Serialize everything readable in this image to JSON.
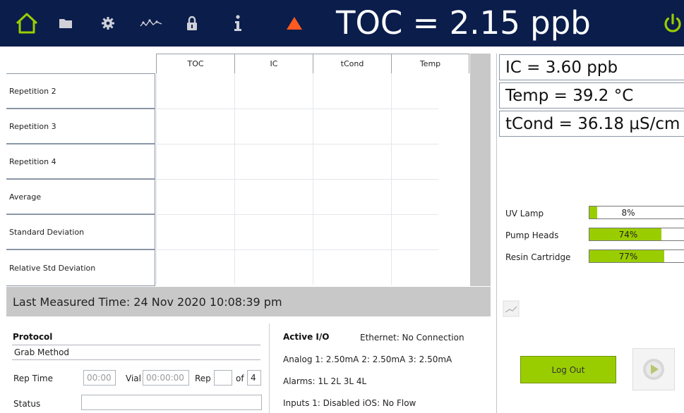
{
  "header": {
    "title": "TOC = 2.15 ppb",
    "icons": [
      "home-icon",
      "folder-icon",
      "gear-icon",
      "trend-icon",
      "lock-icon",
      "info-icon",
      "warning-triangle-icon",
      "power-icon"
    ],
    "colors": {
      "bar": "#0a1d4b",
      "home": "#9acd00",
      "warning": "#ff5a1f",
      "power": "#9acd00"
    }
  },
  "results_table": {
    "columns": [
      "TOC",
      "IC",
      "tCond",
      "Temp"
    ],
    "rows": [
      "Repetition 2",
      "Repetition 3",
      "Repetition 4",
      "Average",
      "Standard Deviation",
      "Relative Std Deviation"
    ],
    "last_measured": "Last Measured Time:  24 Nov 2020  10:08:39 pm"
  },
  "readouts": {
    "ic": "IC = 3.60 ppb",
    "temp": "Temp = 39.2 °C",
    "tcond": "tCond = 36.18 μS/cm"
  },
  "consumables": [
    {
      "label": "UV Lamp",
      "percent": 8,
      "text": "8%"
    },
    {
      "label": "Pump Heads",
      "percent": 74,
      "text": "74%"
    },
    {
      "label": "Resin Cartridge",
      "percent": 77,
      "text": "77%"
    }
  ],
  "protocol": {
    "title": "Protocol",
    "method": "Grab Method",
    "rep_time_label": "Rep Time",
    "rep_time_value": "00:00",
    "vial_label": "Vial",
    "vial_value": "00:00:00",
    "rep_label": "Rep",
    "of_label": "of",
    "rep_total": "4",
    "status_label": "Status",
    "status_value": ""
  },
  "active_io": {
    "title": "Active I/O",
    "ethernet": "Ethernet: No Connection",
    "analog": "Analog 1: 2.50mA  2: 2.50mA  3: 2.50mA",
    "alarms": "Alarms: 1L 2L 3L 4L",
    "inputs": "Inputs 1: Disabled  iOS: No Flow"
  },
  "controls": {
    "logout": "Log Out",
    "accent": "#9acd00"
  }
}
